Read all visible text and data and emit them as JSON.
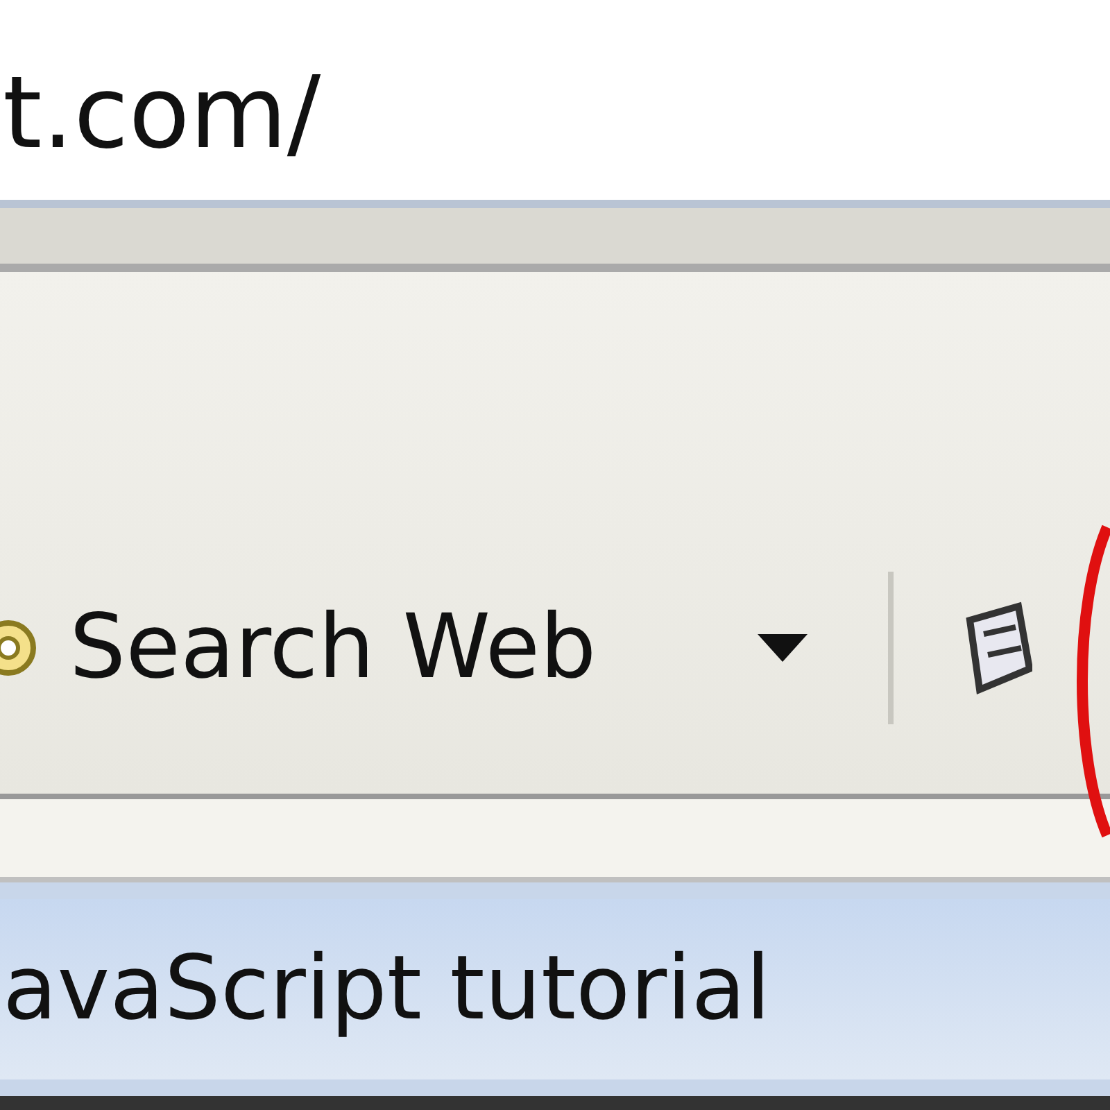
{
  "address_bar": {
    "value": "t.com/"
  },
  "toolbar": {
    "search_button": {
      "label": "Search Web"
    }
  },
  "tab": {
    "title": "avaScript tutorial"
  }
}
